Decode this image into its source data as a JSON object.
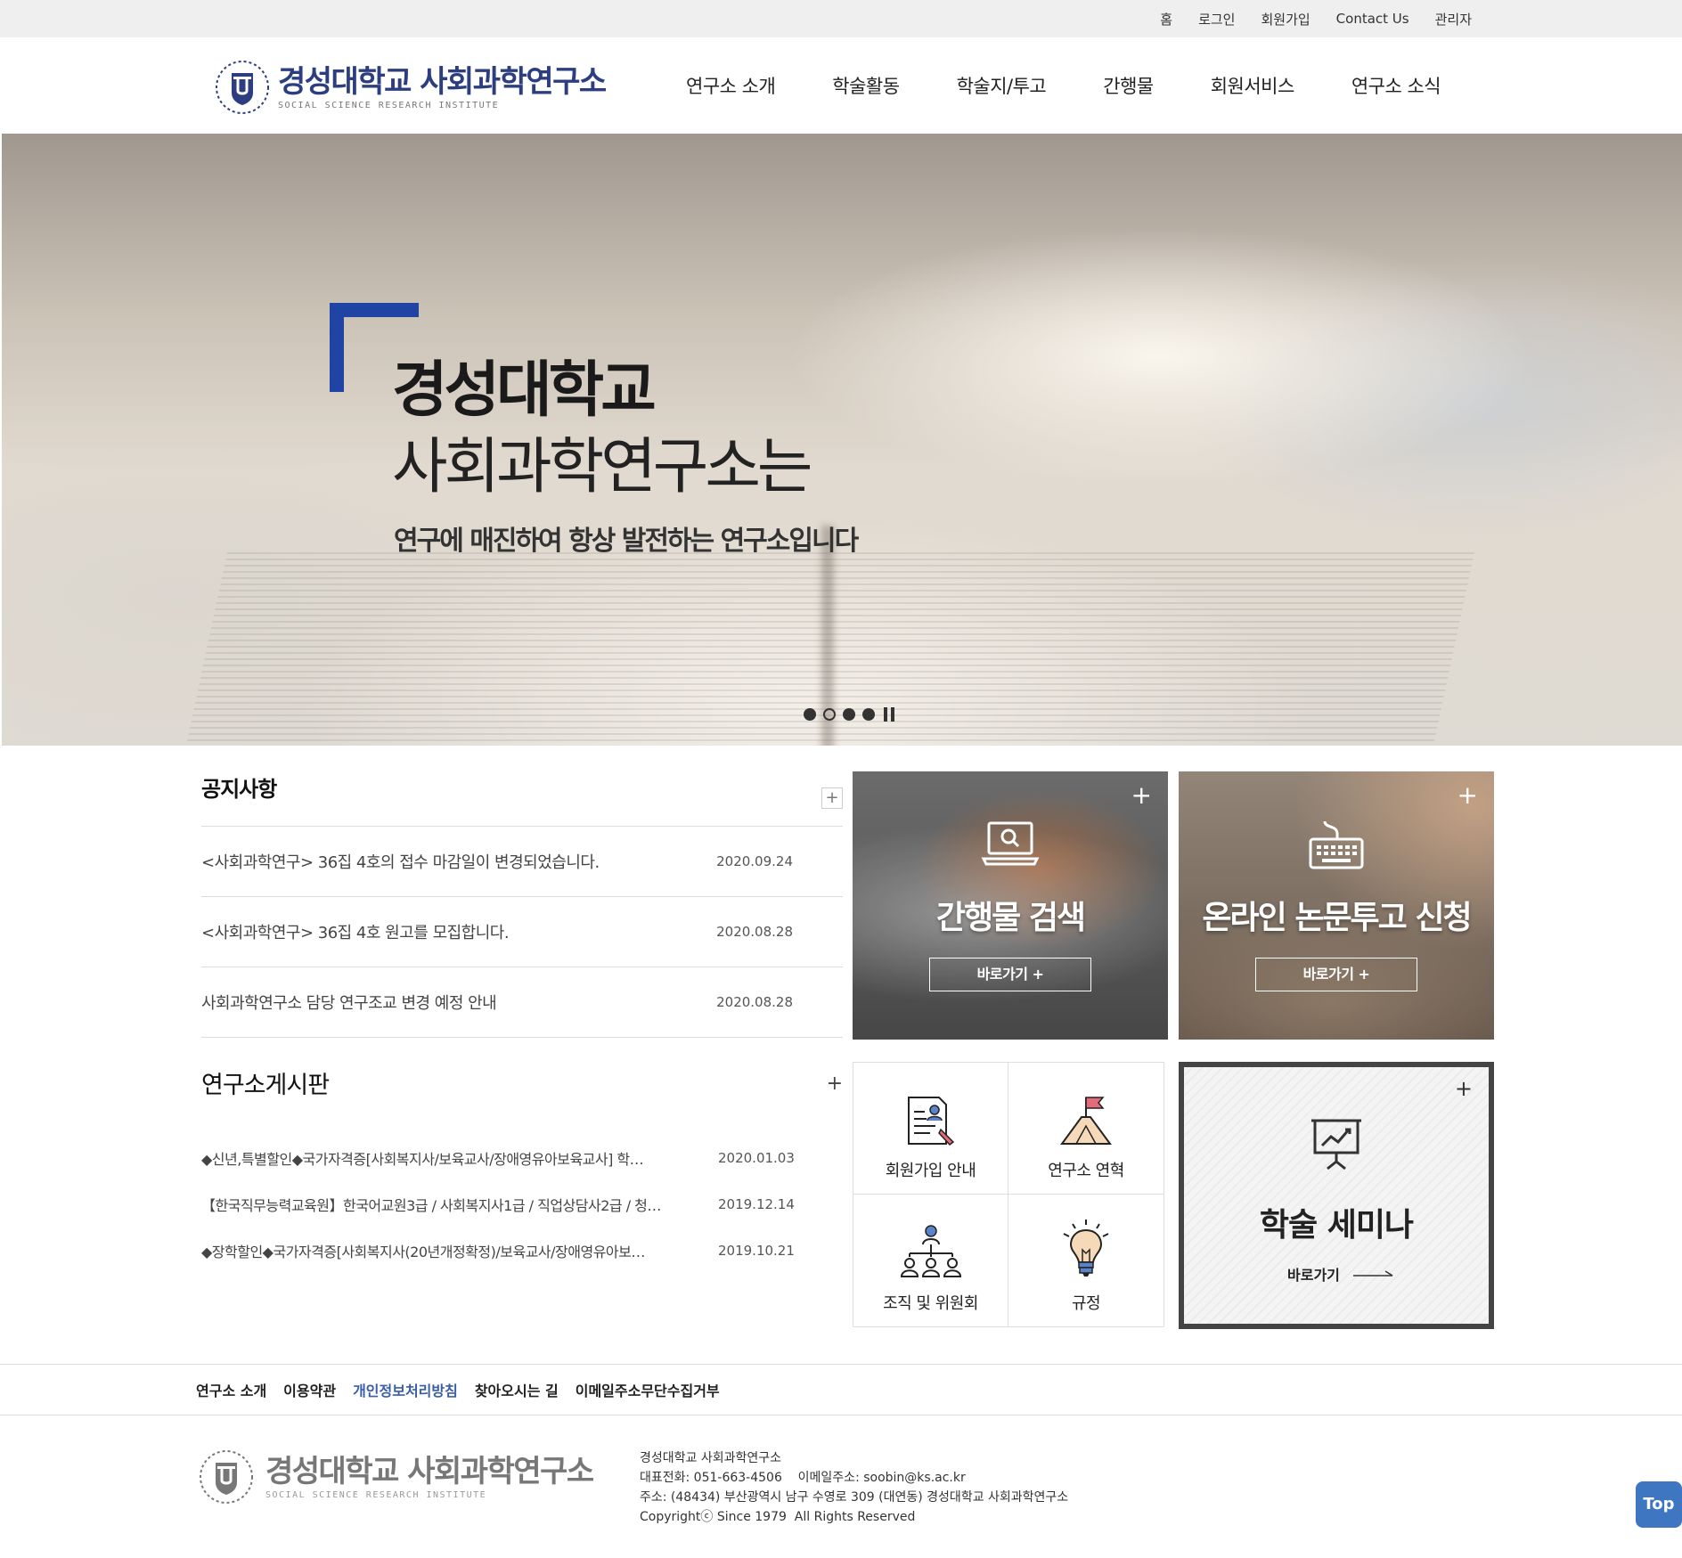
{
  "topbar": {
    "links": [
      "홈",
      "로그인",
      "회원가입",
      "Contact Us",
      "관리자"
    ]
  },
  "header": {
    "logo_name": "경성대학교 사회과학연구소",
    "logo_sub": "SOCIAL SCIENCE RESEARCH INSTITUTE",
    "nav": [
      "연구소 소개",
      "학술활동",
      "학술지/투고",
      "간행물",
      "회원서비스",
      "연구소 소식"
    ]
  },
  "hero": {
    "line1": "경성대학교",
    "line2": "사회과학연구소는",
    "line3": "연구에 매진하여 항상 발전하는 연구소입니다"
  },
  "notice": {
    "title": "공지사항",
    "more": "+",
    "items": [
      {
        "title": "<사회과학연구> 36집 4호의 접수 마감일이 변경되었습니다.",
        "date": "2020.09.24"
      },
      {
        "title": "<사회과학연구> 36집 4호 원고를 모집합니다.",
        "date": "2020.08.28"
      },
      {
        "title": "사회과학연구소 담당 연구조교 변경 예정 안내",
        "date": "2020.08.28"
      }
    ]
  },
  "board": {
    "title": "연구소게시판",
    "more": "+",
    "items": [
      {
        "title": "◆신년,특별할인◆국가자격증[사회복지사/보육교사/장애영유아보육교사] 학…",
        "date": "2020.01.03"
      },
      {
        "title": "【한국직무능력교육원】한국어교원3급 / 사회복지사1급 / 직업상담사2급 / 청…",
        "date": "2019.12.14"
      },
      {
        "title": "◆장학할인◆국가자격증[사회복지사(20년개정확정)/보육교사/장애영유아보…",
        "date": "2019.10.21"
      }
    ]
  },
  "cards": {
    "publication": {
      "title": "간행물 검색",
      "button": "바로가기 +",
      "plus": "+",
      "icon": "laptop-search-icon"
    },
    "submission": {
      "title": "온라인 논문투고 신청",
      "button": "바로가기 +",
      "plus": "+",
      "icon": "keyboard-icon"
    }
  },
  "quick": [
    {
      "label": "회원가입 안내",
      "icon": "document-user-icon"
    },
    {
      "label": "연구소 연혁",
      "icon": "flag-mountain-icon"
    },
    {
      "label": "조직 및 위원회",
      "icon": "org-chart-icon"
    },
    {
      "label": "규정",
      "icon": "lightbulb-icon"
    }
  ],
  "seminar": {
    "title": "학술 세미나",
    "button": "바로가기",
    "plus": "+",
    "icon": "presentation-chart-icon"
  },
  "footer": {
    "links": [
      "연구소 소개",
      "이용약관",
      "개인정보처리방침",
      "찾아오시는 길",
      "이메일주소무단수집거부"
    ],
    "logo_name": "경성대학교 사회과학연구소",
    "logo_sub": "SOCIAL SCIENCE RESEARCH INSTITUTE",
    "info_name": "경성대학교 사회과학연구소",
    "info_phone": "대표전화: 051-663-4506    이메일주소: soobin@ks.ac.kr",
    "info_address": "주소: (48434) 부산광역시 남구 수영로 309 (대연동) 경성대학교 사회과학연구소",
    "info_copyright": "Copyrightⓒ Since 1979  All Rights Reserved"
  },
  "top_button": "Top",
  "colors": {
    "accent": "#1f44a3",
    "logo": "#2c3e7f",
    "privacy_link": "#3a5da8",
    "top_button": "#3f76c1"
  },
  "slider": {
    "slides": 4,
    "active": 2
  }
}
